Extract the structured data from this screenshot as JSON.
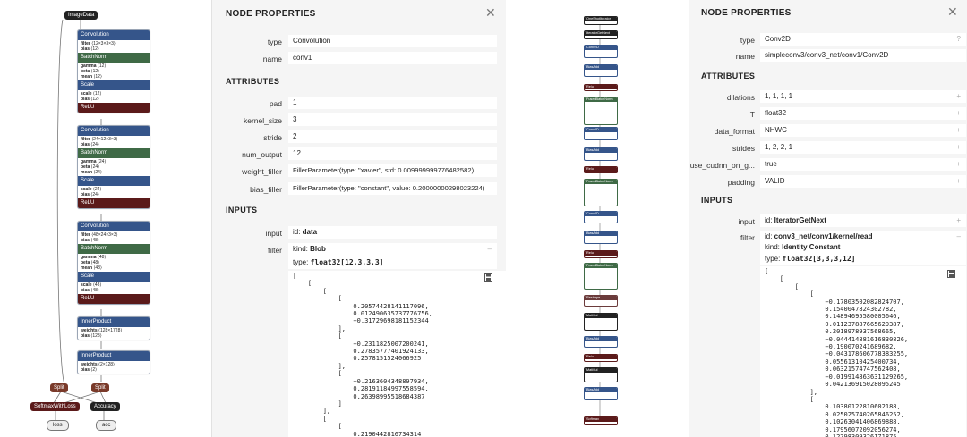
{
  "left_graph": {
    "input_node": "ImageData",
    "block1": {
      "conv": {
        "title": "Convolution",
        "attrs": [
          [
            "filter",
            "⟨12×3×3×3⟩"
          ],
          [
            "bias",
            "⟨12⟩"
          ]
        ]
      },
      "bn": {
        "title": "BatchNorm",
        "attrs": [
          [
            "gamma",
            "⟨12⟩"
          ],
          [
            "beta",
            "⟨12⟩"
          ],
          [
            "mean",
            "⟨12⟩"
          ]
        ]
      },
      "scale": {
        "title": "Scale",
        "attrs": [
          [
            "scale",
            "⟨12⟩"
          ],
          [
            "bias",
            "⟨12⟩"
          ]
        ]
      },
      "relu": "ReLU"
    },
    "block2": {
      "conv": {
        "title": "Convolution",
        "attrs": [
          [
            "filter",
            "⟨24×12×3×3⟩"
          ],
          [
            "bias",
            "⟨24⟩"
          ]
        ]
      },
      "bn": {
        "title": "BatchNorm",
        "attrs": [
          [
            "gamma",
            "⟨24⟩"
          ],
          [
            "beta",
            "⟨24⟩"
          ],
          [
            "mean",
            "⟨24⟩"
          ]
        ]
      },
      "scale": {
        "title": "Scale",
        "attrs": [
          [
            "scale",
            "⟨24⟩"
          ],
          [
            "bias",
            "⟨24⟩"
          ]
        ]
      },
      "relu": "ReLU"
    },
    "block3": {
      "conv": {
        "title": "Convolution",
        "attrs": [
          [
            "filter",
            "⟨48×24×3×3⟩"
          ],
          [
            "bias",
            "⟨48⟩"
          ]
        ]
      },
      "bn": {
        "title": "BatchNorm",
        "attrs": [
          [
            "gamma",
            "⟨48⟩"
          ],
          [
            "beta",
            "⟨48⟩"
          ],
          [
            "mean",
            "⟨48⟩"
          ]
        ]
      },
      "scale": {
        "title": "Scale",
        "attrs": [
          [
            "scale",
            "⟨48⟩"
          ],
          [
            "bias",
            "⟨48⟩"
          ]
        ]
      },
      "relu": "ReLU"
    },
    "ip1": {
      "title": "InnerProduct",
      "attrs": [
        [
          "weights",
          "⟨128×1728⟩"
        ],
        [
          "bias",
          "⟨128⟩"
        ]
      ]
    },
    "ip2": {
      "title": "InnerProduct",
      "attrs": [
        [
          "weights",
          "⟨2×128⟩"
        ],
        [
          "bias",
          "⟨2⟩"
        ]
      ]
    },
    "split1": "Split",
    "split2": "Split",
    "loss_node": "SoftmaxWithLoss",
    "acc_node": "Accuracy",
    "out_loss": "loss",
    "out_acc": "acc"
  },
  "left_panel": {
    "title": "NODE PROPERTIES",
    "close": "✕",
    "type_label": "type",
    "type_value": "Convolution",
    "name_label": "name",
    "name_value": "conv1",
    "attributes_heading": "ATTRIBUTES",
    "attributes": [
      {
        "label": "pad",
        "value": "1"
      },
      {
        "label": "kernel_size",
        "value": "3"
      },
      {
        "label": "stride",
        "value": "2"
      },
      {
        "label": "num_output",
        "value": "12"
      },
      {
        "label": "weight_filler",
        "value": "FillerParameter(type: \"xavier\", std: 0.009999999776482582)"
      },
      {
        "label": "bias_filler",
        "value": "FillerParameter(type: \"constant\", value: 0.20000000298023224)"
      }
    ],
    "inputs_heading": "INPUTS",
    "input_label": "input",
    "input_id_prefix": "id: ",
    "input_id": "data",
    "filter_label": "filter",
    "filter_kind_prefix": "kind: ",
    "filter_kind": "Blob",
    "filter_type_prefix": "type: ",
    "filter_type": "float32[12,3,3,3]",
    "collapse": "–",
    "tensor_text": "[\n    [\n        [\n            [\n                0.20574428141117096,\n                0.012490635737776756,\n                −0.31729698181152344\n            ],\n            [\n                −0.2311825007200241,\n                0.27835777401924133,\n                0.2578151524066925\n            ],\n            [\n                −0.2163604348897934,\n                0.28191184997558594,\n                0.26398995518684387\n            ]\n        ],\n        [\n            [\n                0.2190442816734314"
  },
  "right_graph": {
    "nodes": [
      "OneShotIterator",
      "IteratorGetNext",
      "Conv2D",
      "BiasAdd",
      "Relu",
      "FusedBatchNorm",
      "Conv2D",
      "BiasAdd",
      "Relu",
      "FusedBatchNorm",
      "Conv2D",
      "BiasAdd",
      "Relu",
      "FusedBatchNorm",
      "Reshape",
      "MatMul",
      "BiasAdd",
      "Relu",
      "MatMul",
      "BiasAdd",
      "Softmax"
    ]
  },
  "right_panel": {
    "title": "NODE PROPERTIES",
    "close": "✕",
    "type_label": "type",
    "type_value": "Conv2D",
    "type_mark": "?",
    "name_label": "name",
    "name_value": "simpleconv3/conv3_net/conv1/Conv2D",
    "attributes_heading": "ATTRIBUTES",
    "attributes": [
      {
        "label": "dilations",
        "value": "1, 1, 1, 1"
      },
      {
        "label": "T",
        "value": "float32"
      },
      {
        "label": "data_format",
        "value": "NHWC"
      },
      {
        "label": "strides",
        "value": "1, 2, 2, 1"
      },
      {
        "label": "use_cudnn_on_g...",
        "value": "true"
      },
      {
        "label": "padding",
        "value": "VALID"
      }
    ],
    "plus": "+",
    "inputs_heading": "INPUTS",
    "input_label": "input",
    "input_id_prefix": "id: ",
    "input_id": "IteratorGetNext",
    "filter_label": "filter",
    "filter_id_prefix": "id: ",
    "filter_id": "conv3_net/conv1/kernel/read",
    "filter_kind_prefix": "kind: ",
    "filter_kind": "Identity Constant",
    "filter_type_prefix": "type: ",
    "filter_type": "float32[3,3,3,12]",
    "collapse": "–",
    "tensor_text": "[\n    [\n        [\n            [\n                −0.17803502082824707,\n                0.1540047824302782,\n                0.14894695580005646,\n                0.011237887665629387,\n                0.2018978937568665,\n                −0.044414881616830826,\n                −0.190070241689682,\n                −0.043178606778383255,\n                0.05561310425400734,\n                0.06321574747562408,\n                −0.019914863631129265,\n                0.042136915028095245\n            ],\n            [\n                0.10380122810602188,\n                0.025025740265846252,\n                0.10263041406869888,\n                0.17956072092056274,\n                0.12798309326171875,"
  }
}
